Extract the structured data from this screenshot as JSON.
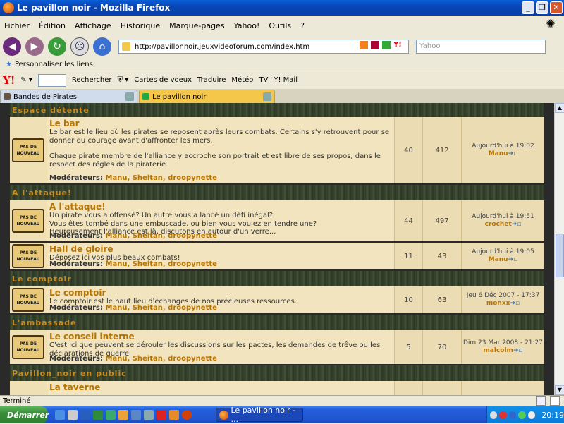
{
  "window": {
    "title": "Le pavillon noir - Mozilla Firefox"
  },
  "menu": [
    "Fichier",
    "Édition",
    "Affichage",
    "Historique",
    "Marque-pages",
    "Yahoo!",
    "Outils",
    "?"
  ],
  "address": {
    "url": "http://pavillonnoir.jeuxvideoforum.com/index.htm"
  },
  "search": {
    "placeholder": "Yahoo"
  },
  "bookmarks": {
    "item": "Personnaliser les liens"
  },
  "ytoolbar": {
    "logo": "Y!",
    "rechercher": "Rechercher",
    "cartes": "Cartes de voeux",
    "traduire": "Traduire",
    "meteo": "Météo",
    "tv": "TV",
    "ymail": "Y! Mail"
  },
  "tabs": [
    {
      "label": "Bandes de Pirates"
    },
    {
      "label": "Le pavillon noir"
    }
  ],
  "icon_text": {
    "line1": "PAS DE",
    "line2": "NOUVEAU"
  },
  "forum": {
    "mods_label": "Modérateurs:",
    "cat1": "Espace détente",
    "f1": {
      "title": "Le bar",
      "d1": "Le bar est le lieu où les pirates se reposent après leurs combats. Certains s'y retrouvent pour se",
      "d2": "donner du courage avant d'affronter les mers.",
      "d3": "Chaque pirate membre de l'alliance y accroche son portrait et est libre de ses propos, dans le",
      "d4": "respect des régles de la piraterie.",
      "mods": "Manu, Sheitan, droopynette",
      "topics": "40",
      "posts": "412",
      "last_date": "Aujourd'hui à 19:02",
      "last_author": "Manu"
    },
    "cat2": "A l'attaque!",
    "f2": {
      "title": "A l'attaque!",
      "d1": "Un pirate vous a offensé? Un autre vous a lancé un défi inégal?",
      "d2": "Vous êtes tombé dans une embuscade, ou bien vous voulez en tendre une?",
      "d3": "Heureusement l'alliance est là, discutons en autour d'un verre...",
      "mods": "Manu, Sheitan, droopynette",
      "topics": "44",
      "posts": "497",
      "last_date": "Aujourd'hui à 19:51",
      "last_author": "crochet"
    },
    "f3": {
      "title": "Hall de gloire",
      "d1": "Déposez ici vos plus beaux combats!",
      "mods": "Manu, Sheitan, droopynette",
      "topics": "11",
      "posts": "43",
      "last_date": "Aujourd'hui à 19:05",
      "last_author": "Manu"
    },
    "cat3": "Le comptoir",
    "f4": {
      "title": "Le comptoir",
      "d1": "Le comptoir est le haut lieu d'échanges de nos précieuses ressources.",
      "mods": "Manu, Sheitan, droopynette",
      "topics": "10",
      "posts": "63",
      "last_date": "Jeu 6 Déc 2007 - 17:37",
      "last_author": "monxx"
    },
    "cat4": "L'ambassade",
    "f5": {
      "title": "Le conseil interne",
      "d1": "C'est ici que peuvent se dérouler les discussions sur les pactes, les demandes de trêve ou les",
      "d2": "déclarations de guerre",
      "mods": "Manu, Sheitan, droopynette",
      "topics": "5",
      "posts": "70",
      "last_date": "Dim 23 Mar 2008 - 21:27",
      "last_author": "malcolm"
    },
    "cat5": "Pavillon_noir en public",
    "f6": {
      "title": "La taverne"
    }
  },
  "status": {
    "text": "Terminé"
  },
  "taskbar": {
    "start": "Démarrer",
    "task": "Le pavillon noir - ...",
    "clock": "20:19"
  }
}
